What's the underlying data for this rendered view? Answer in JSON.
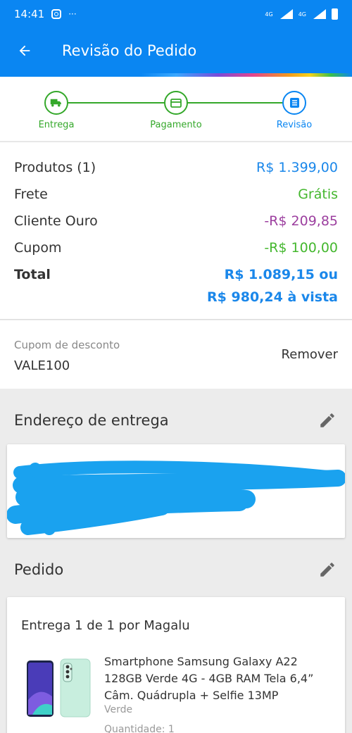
{
  "status_bar": {
    "time": "14:41",
    "signal_left": "4G",
    "signal_right": "4G"
  },
  "header": {
    "title": "Revisão do Pedido"
  },
  "stepper": {
    "steps": [
      {
        "label": "Entrega",
        "icon": "truck-icon",
        "state": "done"
      },
      {
        "label": "Pagamento",
        "icon": "credit-card-icon",
        "state": "done"
      },
      {
        "label": "Revisão",
        "icon": "list-icon",
        "state": "active"
      }
    ]
  },
  "summary": {
    "products_label": "Produtos (1)",
    "products_value": "R$ 1.399,00",
    "shipping_label": "Frete",
    "shipping_value": "Grátis",
    "gold_label": "Cliente Ouro",
    "gold_value": "-R$ 209,85",
    "coupon_label": "Cupom",
    "coupon_value": "-R$ 100,00",
    "total_label": "Total",
    "total_value": "R$ 1.089,15 ou",
    "total_cash": "R$ 980,24 à vista"
  },
  "coupon": {
    "label": "Cupom de desconto",
    "code": "VALE100",
    "remove": "Remover"
  },
  "address": {
    "title": "Endereço de entrega"
  },
  "order": {
    "title": "Pedido",
    "delivery": "Entrega 1 de 1 por Magalu",
    "product_name": "Smartphone Samsung Galaxy A22 128GB Verde 4G - 4GB RAM Tela 6,4” Câm. Quádrupla + Selfie 13MP",
    "color": "Verde",
    "quantity": "Quantidade: 1"
  },
  "colors": {
    "primary": "#0a86f2",
    "green": "#34a82a",
    "price_blue": "#1a87ea",
    "discount_purple": "#9c3f9f",
    "discount_green": "#44b72e"
  }
}
